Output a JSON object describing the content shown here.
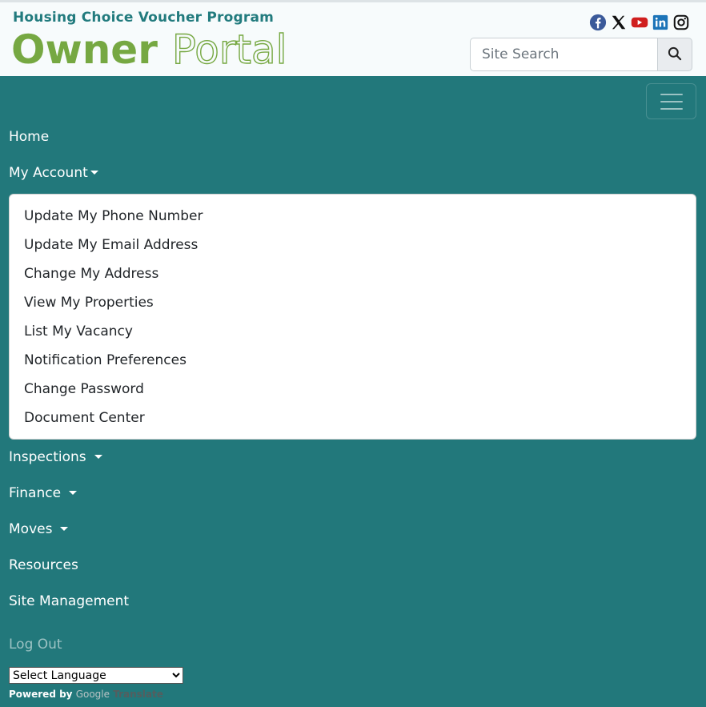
{
  "header": {
    "program": "Housing Choice Voucher Program",
    "logo_owner": "Owner",
    "logo_portal": "Portal"
  },
  "social": [
    "facebook-icon",
    "x-icon",
    "youtube-icon",
    "linkedin-icon",
    "instagram-icon"
  ],
  "search": {
    "placeholder": "Site Search"
  },
  "nav": {
    "home": "Home",
    "my_account": "My Account",
    "account_menu": [
      "Update My Phone Number",
      "Update My Email Address",
      "Change My Address",
      "View My Properties",
      "List My Vacancy",
      "Notification Preferences",
      "Change Password",
      "Document Center"
    ],
    "inspections": "Inspections",
    "finance": "Finance",
    "moves": "Moves",
    "resources": "Resources",
    "site_management": "Site Management",
    "log_out": "Log Out"
  },
  "translate": {
    "select_label": "Select Language",
    "powered_by": "Powered by",
    "google": "Google",
    "translate": "Translate"
  },
  "colors": {
    "teal": "#22787b",
    "green": "#76a842",
    "program_text": "#227b7e"
  }
}
